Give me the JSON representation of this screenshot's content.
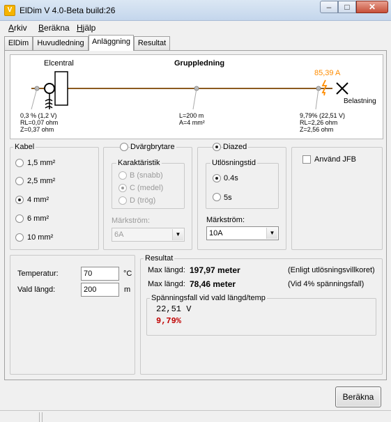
{
  "window": {
    "title": "ElDim V 4.0-Beta build:26",
    "icon_glyph": "V",
    "controls": {
      "minimize": "–",
      "maximize": "□",
      "close": "✕"
    }
  },
  "menu": [
    "Arkiv",
    "Beräkna",
    "Hjälp"
  ],
  "tabs": [
    {
      "label": "ElDim",
      "active": false
    },
    {
      "label": "Huvudledning",
      "active": false
    },
    {
      "label": "Anläggning",
      "active": true
    },
    {
      "label": "Resultat",
      "active": false
    }
  ],
  "diagram": {
    "title": "Gruppledning",
    "source_label": "Elcentral",
    "load_label": "Belastning",
    "current_label": "85,39 A",
    "current_color": "#ff8c00",
    "line_color": "#8b5a1e",
    "left_info": [
      "0,3 % (1,2 V)",
      "RL=0,07 ohm",
      "Z=0,37 ohm"
    ],
    "mid_info": [
      "L=200 m",
      "A=4 mm²"
    ],
    "right_info": [
      "9,79% (22,51 V)",
      "RL=2,26 ohm",
      "Z=2,56 ohm"
    ]
  },
  "kabel": {
    "legend": "Kabel",
    "options": [
      {
        "label": "1,5 mm²",
        "checked": false
      },
      {
        "label": "2,5 mm²",
        "checked": false
      },
      {
        "label": "4 mm²",
        "checked": true
      },
      {
        "label": "6 mm²",
        "checked": false
      },
      {
        "label": "10 mm²",
        "checked": false
      }
    ]
  },
  "dvargbrytare": {
    "legend": "Dvärgbrytare",
    "checked": false,
    "karakteristik": {
      "legend": "Karaktäristik",
      "options": [
        {
          "label": "B  (snabb)",
          "checked": false
        },
        {
          "label": "C  (medel)",
          "checked": true
        },
        {
          "label": "D  (trög)",
          "checked": false
        }
      ]
    },
    "markstrom_label": "Märkström:",
    "markstrom_value": "6A"
  },
  "diazed": {
    "legend": "Diazed",
    "checked": true,
    "utlosningstid": {
      "legend": "Utlösningstid",
      "options": [
        {
          "label": "0.4s",
          "checked": true
        },
        {
          "label": "5s",
          "checked": false
        }
      ]
    },
    "markstrom_label": "Märkström:",
    "markstrom_value": "10A"
  },
  "jfb": {
    "label": "Använd JFB",
    "checked": false
  },
  "inputs": {
    "temp_label": "Temperatur:",
    "temp_value": "70",
    "temp_unit": "°C",
    "length_label": "Vald längd:",
    "length_value": "200",
    "length_unit": "m"
  },
  "resultat": {
    "legend": "Resultat",
    "rows": [
      {
        "label": "Max längd:",
        "value": "197,97 meter",
        "note": "(Enligt utlösningsvillkoret)"
      },
      {
        "label": "Max längd:",
        "value": "78,46 meter",
        "note": "(Vid 4% spänningsfall)"
      }
    ],
    "spanningsfall": {
      "legend": "Spänningsfall vid vald längd/temp",
      "volt": "22,51 V",
      "percent": "9,79%",
      "percent_color": "#c00000"
    }
  },
  "buttons": {
    "berakna": "Beräkna"
  }
}
